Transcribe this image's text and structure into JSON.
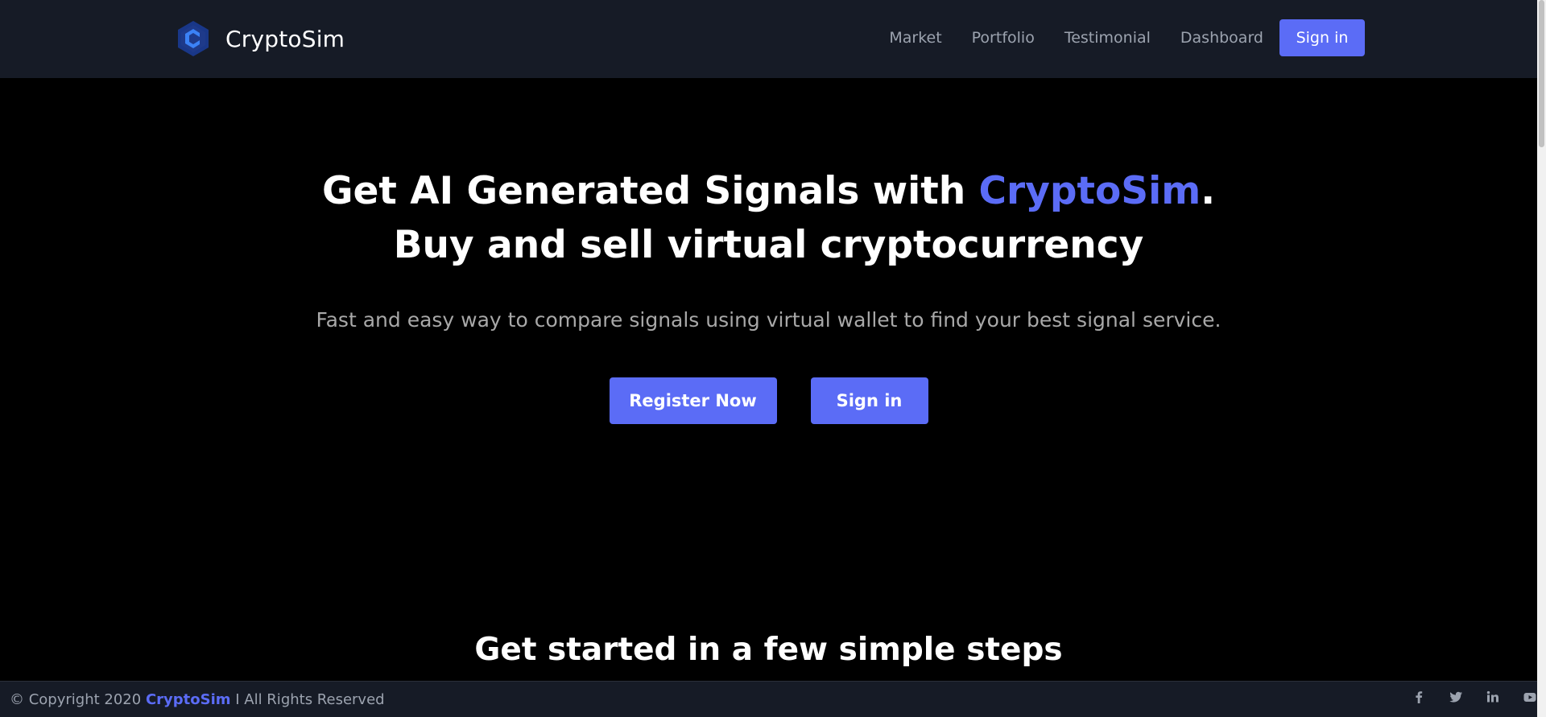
{
  "brand": {
    "name": "CryptoSim",
    "logo_icon": "hexagon-c-logo"
  },
  "nav": {
    "links": [
      "Market",
      "Portfolio",
      "Testimonial",
      "Dashboard"
    ],
    "signin_label": "Sign in"
  },
  "hero": {
    "title_part1": "Get AI Generated Signals with ",
    "title_accent": "CryptoSim",
    "title_part2": ".",
    "title_line2": "Buy and sell virtual cryptocurrency",
    "subtitle": "Fast and easy way to compare signals using virtual wallet to find your best signal service.",
    "register_label": "Register Now",
    "signin_label": "Sign in"
  },
  "steps": {
    "heading": "Get started in a few simple steps"
  },
  "footer": {
    "copyright_prefix": "© Copyright 2020 ",
    "copyright_brand": "CryptoSim",
    "copyright_suffix": " I All Rights Reserved",
    "socials": [
      "facebook-icon",
      "twitter-icon",
      "linkedin-icon",
      "youtube-icon"
    ]
  },
  "colors": {
    "accent": "#5b6cf6",
    "header_bg": "#161b26",
    "page_bg": "#000000",
    "muted_text": "#9ca3af"
  }
}
